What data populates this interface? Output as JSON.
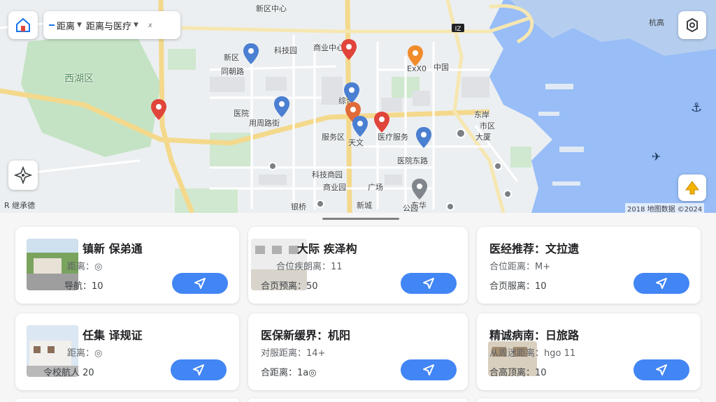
{
  "filter_bar": {
    "distance_label": "距离",
    "sort_label": "距离与医疗",
    "extra_label": "𝘹"
  },
  "map": {
    "top_right_label": "杭高",
    "bottom_left_label": "R 继承德",
    "attribution": "2018 地图数据 ©2024",
    "labels": {
      "l1": "新区中心",
      "l2": "西湖区",
      "l3": "科技园",
      "l4": "同朝路",
      "l5": "商业中心",
      "l6": "ExX0",
      "l7": "中国",
      "l8": "医院",
      "l9": "用周路街",
      "l10": "综合",
      "l11": "医疗服务",
      "l12": "天文",
      "l13": "服务区",
      "l14": "医院东路",
      "l15": "科技商园",
      "l16": "商业园",
      "l17": "广场",
      "l18": "新区",
      "l19": "东岸",
      "l20": "市区",
      "l21": "大厦",
      "l22": "银桥",
      "l23": "新城",
      "l24": "公园",
      "l25": "东华"
    }
  },
  "cards": [
    {
      "title": "镇新 保弟通",
      "line1": "距离：◎",
      "line2": "导航：10"
    },
    {
      "title": "大际 疾泽构",
      "line1": "合位疾朗离：11",
      "line2": "合页预离：50"
    },
    {
      "title": "医经推荐：文拉遗",
      "line1": "合位距离：M+",
      "line2": "合页服离：10"
    },
    {
      "title": "任集 译规证",
      "line1": "距离：◎",
      "line2": "令校航人 20"
    },
    {
      "title": "医保新缓界：机阳",
      "line1": "对服距离：14+",
      "line2": "合距离：1a◎"
    },
    {
      "title": "精诚病南：日旅路",
      "line1": "从周迷距离：hgo 11",
      "line2": "合高顶离：10"
    }
  ],
  "colors": {
    "pin_red": "#e0443a",
    "pin_blue": "#4a7fd1",
    "pin_orange": "#f08c2b",
    "pin_gray": "#80868b",
    "go_button": "#4285f4"
  }
}
